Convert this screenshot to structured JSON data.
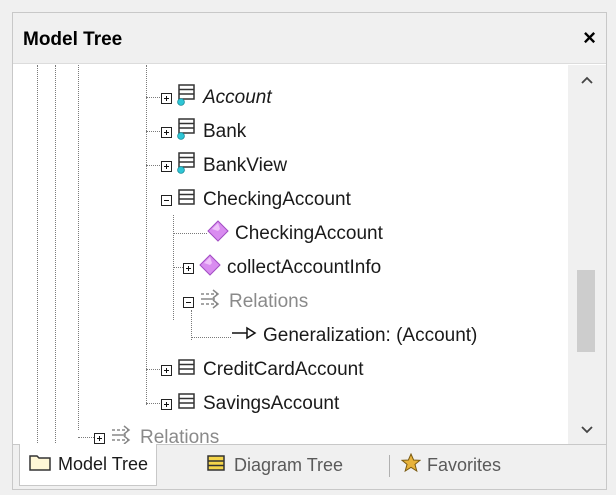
{
  "panel": {
    "title": "Model Tree",
    "close_label": "×"
  },
  "tree": {
    "items": [
      {
        "label": "Account",
        "italic": true,
        "expander": "plus",
        "icon": "class-icon-linked"
      },
      {
        "label": "Bank",
        "expander": "plus",
        "icon": "class-icon-linked"
      },
      {
        "label": "BankView",
        "expander": "plus",
        "icon": "class-icon-linked"
      },
      {
        "label": "CheckingAccount",
        "expander": "minus",
        "icon": "class-icon"
      },
      {
        "label": "CheckingAccount",
        "icon": "operation-icon"
      },
      {
        "label": "collectAccountInfo",
        "expander": "plus",
        "icon": "operation-icon"
      },
      {
        "label": "Relations",
        "expander": "minus",
        "icon": "relations-icon",
        "gray": true
      },
      {
        "label": "Generalization:  (Account)",
        "icon": "generalization-icon"
      },
      {
        "label": "CreditCardAccount",
        "expander": "plus",
        "icon": "class-icon"
      },
      {
        "label": "SavingsAccount",
        "expander": "plus",
        "icon": "class-icon"
      },
      {
        "label": "Relations",
        "expander": "plus",
        "icon": "relations-icon",
        "gray": true
      }
    ]
  },
  "scrollbar": {
    "up_icon": "chevron-up-icon",
    "down_icon": "chevron-down-icon",
    "up_glyph": "^",
    "down_glyph": "v"
  },
  "tabs": [
    {
      "label": "Model Tree",
      "icon": "folder-icon",
      "active": true
    },
    {
      "label": "Diagram Tree",
      "icon": "diagram-icon",
      "active": false
    },
    {
      "label": "Favorites",
      "icon": "favorites-icon",
      "active": false
    }
  ],
  "colors": {
    "operation": "#d98cf0",
    "link_dot": "#2ec6d6",
    "relations_gray": "#8a8a8a"
  }
}
